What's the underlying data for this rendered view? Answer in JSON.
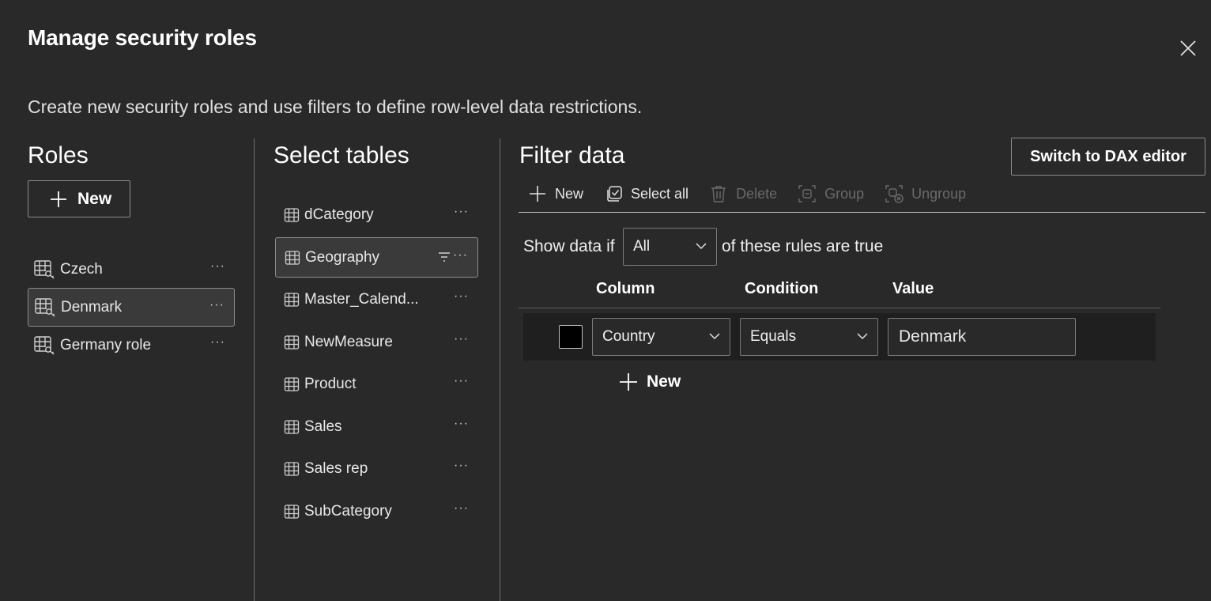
{
  "dialog": {
    "title": "Manage security roles",
    "subtitle": "Create new security roles and use filters to define row-level data restrictions."
  },
  "roles": {
    "heading": "Roles",
    "new_label": "New",
    "items": [
      {
        "label": "Czech",
        "more": "···",
        "selected": false
      },
      {
        "label": "Denmark",
        "more": "···",
        "selected": true
      },
      {
        "label": "Germany role",
        "more": "···",
        "selected": false
      }
    ]
  },
  "tables": {
    "heading": "Select tables",
    "items": [
      {
        "label": "dCategory",
        "more": "···"
      },
      {
        "label": "Geography",
        "more": "···",
        "selected": true,
        "has_filter": true
      },
      {
        "label": "Master_Calend...",
        "more": "···"
      },
      {
        "label": "NewMeasure",
        "more": "···"
      },
      {
        "label": "Product",
        "more": "···"
      },
      {
        "label": "Sales",
        "more": "···"
      },
      {
        "label": "Sales rep",
        "more": "···"
      },
      {
        "label": "SubCategory",
        "more": "···"
      }
    ]
  },
  "filter": {
    "heading": "Filter data",
    "dax_button": "Switch to DAX editor",
    "toolbar": {
      "new": "New",
      "select_all": "Select all",
      "delete": "Delete",
      "group": "Group",
      "ungroup": "Ungroup"
    },
    "show_if_prefix": "Show data if",
    "match_mode": "All",
    "show_if_suffix": "of these rules are true",
    "columns": {
      "column": "Column",
      "condition": "Condition",
      "value": "Value"
    },
    "rules": [
      {
        "column": "Country",
        "condition": "Equals",
        "value": "Denmark"
      }
    ],
    "new_rule_label": "New"
  },
  "icons": {
    "close": "close-icon",
    "role": "role-table-key-icon",
    "table": "table-grid-icon",
    "filter": "filter-icon",
    "more": "more-ellipsis-icon",
    "plus": "plus-icon",
    "select_all": "select-all-icon",
    "delete": "trash-icon",
    "group": "group-icon",
    "ungroup": "ungroup-icon",
    "chevron": "chevron-down-icon"
  }
}
